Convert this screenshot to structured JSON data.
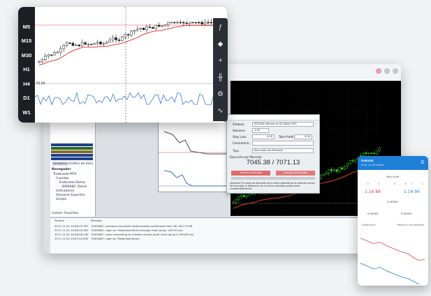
{
  "chart_card": {
    "timeframes": [
      "M5",
      "M15",
      "M30",
      "H1",
      "H4",
      "D1",
      "W1"
    ],
    "indicator_label": "51.64",
    "tools": [
      {
        "icon": "function-icon",
        "glyph": "ƒ"
      },
      {
        "icon": "shapes-icon",
        "glyph": "◆"
      },
      {
        "icon": "crosshair-icon",
        "glyph": "+"
      },
      {
        "icon": "candles-icon",
        "glyph": "╫"
      },
      {
        "icon": "settings-icon",
        "glyph": "⚙"
      },
      {
        "icon": "line-chart-icon",
        "glyph": "∿"
      }
    ],
    "colors": {
      "candle_up": "#ffffff",
      "candle_down": "#1b1b1b",
      "ma_line": "#e23b3b",
      "osc_line": "#3a7ad9"
    }
  },
  "desktop": {
    "navigator": {
      "tabs": [
        "Símbolos",
        "Gráfico de ticks"
      ],
      "header": "Navegador",
      "items": [
        "Tradeview MT4",
        "Cuentas",
        "Tradeview-Demo",
        "3009082: Demo",
        "Indicadores",
        "Asesores Expertos",
        "Scripts"
      ],
      "bottom_tabs": [
        "Común",
        "Favoritos"
      ]
    },
    "order_dialog": {
      "symbol_label": "Símbolo:",
      "symbol_value": "BTCUSD, Bitcoin vs US Dollar (P0)",
      "volume_label": "Volumen:",
      "volume_value": "1.00",
      "stoploss_label": "Stop Loss:",
      "stoploss_value": "0.00",
      "takeprofit_label": "Take Profit:",
      "takeprofit_value": "0.00",
      "comment_label": "Comentario:",
      "type_label": "Tipo:",
      "type_value": "Ejecución por Mercado",
      "exec_label": "Ejecución por Mercado",
      "price": "7045.38 / 7071.13",
      "sell_button": "Vender al Mercado",
      "buy_button": "Comprar al Mercado",
      "note": "¡Atención! El precio de ejecución de la orden depende de la situación actual del mercado, la diferencia con el precio solicitado puede variar considerablemente!"
    },
    "terminal": {
      "col_time": "Tiempo",
      "col_message": "Mensaje",
      "logs": [
        [
          "2017.11.02 10:08:33.397",
          "'3009082': previous successful authorization performed from 181.46.173.98"
        ],
        [
          "2017.11.02 10:08:16.361",
          "'3009082': login on Tradeview-Demo through main (ping: 149.93 ms)"
        ],
        [
          "2017.11.02 10:08:06.240",
          "'3009082': auto connecting to a better access point main (ping is 199.89 ms)"
        ],
        [
          "2017.11.02 10:07:44.630",
          "'3009082': login on Tradeview-Demo"
        ]
      ]
    }
  },
  "phone": {
    "symbol": "EURUSD",
    "subtitle": "Euro vs US Dollar",
    "order_type": "Buy Limit",
    "sell_price": "1.16 88",
    "buy_price": "1.16 90",
    "volume_value": "1.00",
    "price_value": "0.00000",
    "sl_value": "0.00000",
    "tp_value": "0.00000",
    "expiration_label": "Expiración",
    "expiration_value": "Hasta la cancelación"
  }
}
